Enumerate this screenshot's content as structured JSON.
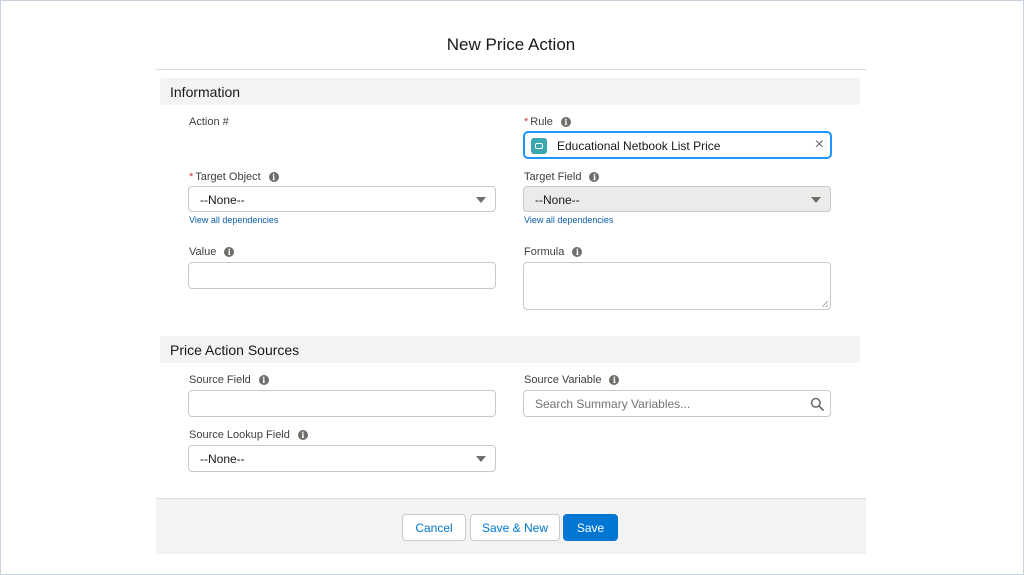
{
  "modal": {
    "title": "New Price Action"
  },
  "sections": {
    "information": "Information",
    "sources": "Price Action Sources"
  },
  "fields": {
    "action_number": {
      "label": "Action #"
    },
    "rule": {
      "label": "Rule",
      "value": "Educational Netbook List Price"
    },
    "target_object": {
      "label": "Target Object",
      "value": "--None--",
      "link": "View all dependencies"
    },
    "target_field": {
      "label": "Target Field",
      "value": "--None--",
      "link": "View all dependencies"
    },
    "value": {
      "label": "Value"
    },
    "formula": {
      "label": "Formula"
    },
    "source_field": {
      "label": "Source Field"
    },
    "source_variable": {
      "label": "Source Variable",
      "placeholder": "Search Summary Variables..."
    },
    "source_lookup_field": {
      "label": "Source Lookup Field",
      "value": "--None--"
    }
  },
  "footer": {
    "cancel": "Cancel",
    "save_new": "Save & New",
    "save": "Save"
  },
  "icons": {
    "required": "*",
    "info": "i",
    "clear": "×"
  },
  "colors": {
    "brand": "#0176d3",
    "required": "#c23934",
    "rule_icon": "#3ba7b1"
  }
}
